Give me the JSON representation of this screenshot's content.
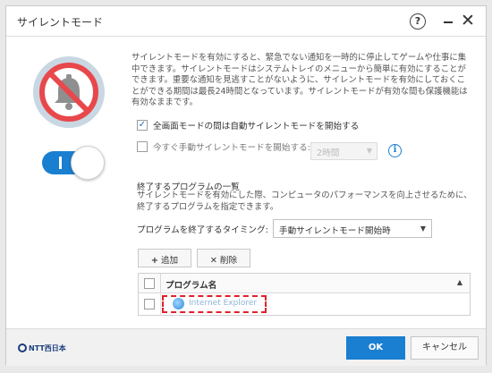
{
  "window": {
    "title": "サイレントモード",
    "help_glyph": "?",
    "close_glyph": "✕"
  },
  "main": {
    "description": "サイレントモードを有効にすると、緊急でない通知を一時的に停止してゲームや仕事に集中できます。サイレントモードはシステムトレイのメニューから簡単に有効にすることができます。重要な通知を見逃すことがないように、サイレントモードを有効にしておくことができる期間は最長24時間となっています。サイレントモードが有効な間も保護機能は有効なままです。",
    "option_fullscreen": {
      "label": "全画面モードの間は自動サイレントモードを開始する",
      "checked": true,
      "check_glyph": "✓"
    },
    "option_manual": {
      "label": "今すぐ手動サイレントモードを開始する:",
      "checked": false
    },
    "duration_select": {
      "value": "2時間",
      "enabled": false
    },
    "info_glyph": "i",
    "section_title": "終了するプログラムの一覧",
    "section_desc": "サイレントモードを有効にした際、コンピュータのパフォーマンスを向上させるために、終了するプログラムを指定できます。",
    "timing_label": "プログラムを終了するタイミング:",
    "timing_select": {
      "value": "手動サイレントモード開始時"
    },
    "add_button": {
      "glyph": "+",
      "label": "追加"
    },
    "delete_button": {
      "glyph": "✕",
      "label": "削除"
    },
    "table": {
      "header": "プログラム名",
      "sort_glyph": "▲",
      "rows": [
        {
          "name": "Internet Explorer"
        }
      ]
    },
    "toggle": {
      "on": true
    }
  },
  "footer": {
    "logo": "NTT西日本",
    "ok_label": "OK",
    "cancel_label": "キャンセル"
  },
  "colors": {
    "accent": "#1a7fd1",
    "bell_ring": "#e8484b",
    "bell_bg": "#c9d7e3",
    "highlight": "#e0202a"
  }
}
